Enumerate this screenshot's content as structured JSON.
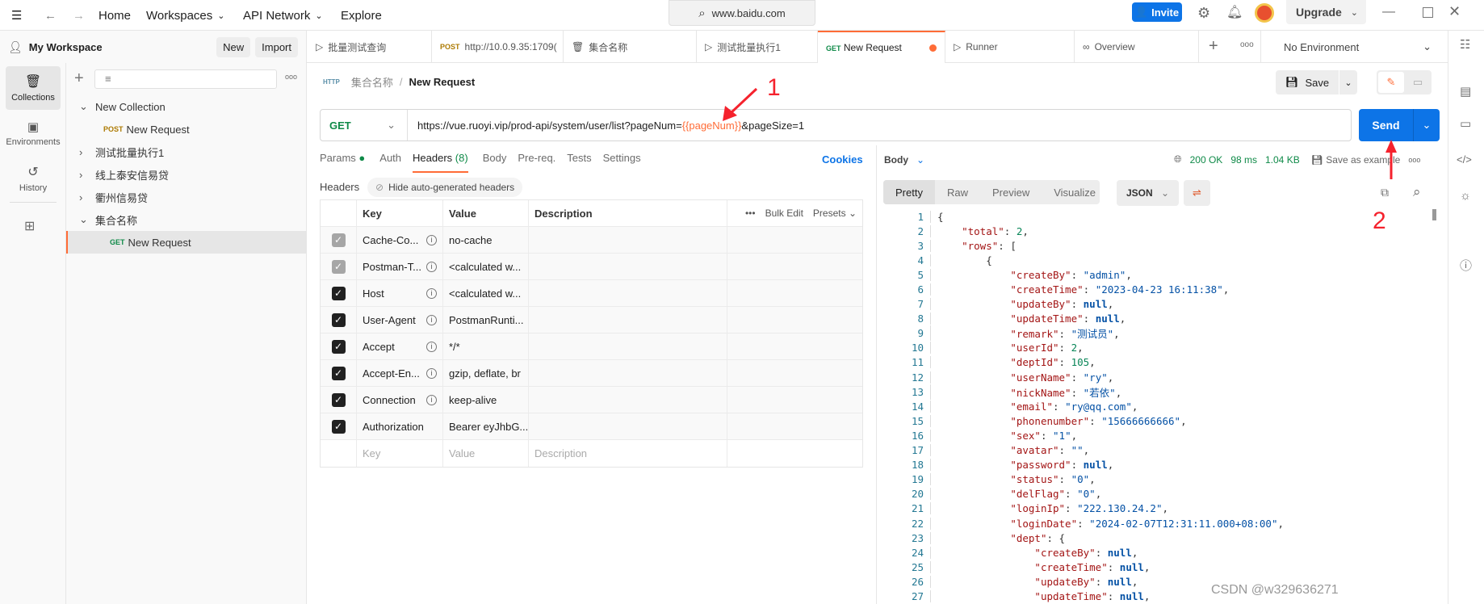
{
  "topbar": {
    "nav": [
      "Home",
      "Workspaces",
      "API Network",
      "Explore"
    ],
    "search": "www.baidu.com",
    "invite": "Invite",
    "upgrade": "Upgrade"
  },
  "workspace": {
    "name": "My Workspace",
    "new": "New",
    "import": "Import"
  },
  "tabs": [
    {
      "method": "",
      "label": "批量测试查询",
      "icon": "runner-icon"
    },
    {
      "method": "POST",
      "label": "http://10.0.9.35:1709("
    },
    {
      "method": "",
      "label": "集合名称",
      "icon": "collection-icon"
    },
    {
      "method": "",
      "label": "测试批量执行1",
      "icon": "runner-icon"
    },
    {
      "method": "GET",
      "label": "New Request",
      "active": true,
      "unsaved": true
    },
    {
      "method": "",
      "label": "Runner",
      "icon": "runner-icon"
    },
    {
      "method": "",
      "label": "Overview",
      "icon": "overview-icon"
    }
  ],
  "environment": "No Environment",
  "rail": [
    {
      "label": "Collections",
      "icon": "collections-icon",
      "selected": true
    },
    {
      "label": "Environments",
      "icon": "environments-icon"
    },
    {
      "label": "History",
      "icon": "history-icon"
    }
  ],
  "tree": [
    {
      "label": "New Collection",
      "expanded": true,
      "level": 0
    },
    {
      "label": "New Request",
      "method": "POST",
      "level": 1
    },
    {
      "label": "测试批量执行1",
      "expanded": false,
      "level": 0
    },
    {
      "label": "线上泰安信易贷",
      "expanded": false,
      "level": 0
    },
    {
      "label": "衢州信易贷",
      "expanded": false,
      "level": 0
    },
    {
      "label": "集合名称",
      "expanded": true,
      "level": 0
    },
    {
      "label": "New Request",
      "method": "GET",
      "level": 1,
      "selected": true
    }
  ],
  "breadcrumb": {
    "parent": "集合名称",
    "sep": "/",
    "current": "New Request"
  },
  "save": "Save",
  "request": {
    "method": "GET",
    "url_prefix": "https://vue.ruoyi.vip/prod-api/system/user/list?pageNum=",
    "url_var": "{{pageNum}}",
    "url_suffix": "&pageSize=1",
    "send": "Send"
  },
  "req_tabs": {
    "params": "Params",
    "auth": "Auth",
    "headers": "Headers",
    "headers_count": "(8)",
    "body": "Body",
    "prereq": "Pre-req.",
    "tests": "Tests",
    "settings": "Settings",
    "cookies": "Cookies"
  },
  "headers_section": {
    "title": "Headers",
    "hide": "Hide auto-generated headers"
  },
  "table": {
    "columns": [
      "Key",
      "Value",
      "Description"
    ],
    "bulk_edit": "Bulk Edit",
    "presets": "Presets",
    "rows": [
      {
        "key": "Cache-Co...",
        "value": "no-cache",
        "checked": true,
        "auto": true
      },
      {
        "key": "Postman-T...",
        "value": "<calculated w...",
        "checked": true,
        "auto": true
      },
      {
        "key": "Host",
        "value": "<calculated w...",
        "checked": true
      },
      {
        "key": "User-Agent",
        "value": "PostmanRunti...",
        "checked": true
      },
      {
        "key": "Accept",
        "value": "*/*",
        "checked": true
      },
      {
        "key": "Accept-En...",
        "value": "gzip, deflate, br",
        "checked": true
      },
      {
        "key": "Connection",
        "value": "keep-alive",
        "checked": true
      },
      {
        "key": "Authorization",
        "value": "Bearer eyJhbG...",
        "checked": true
      }
    ],
    "placeholders": {
      "key": "Key",
      "value": "Value",
      "description": "Description"
    }
  },
  "response": {
    "body_label": "Body",
    "status": "200 OK",
    "time": "98 ms",
    "size": "1.04 KB",
    "save_example": "Save as example",
    "views": [
      "Pretty",
      "Raw",
      "Preview",
      "Visualize"
    ],
    "format": "JSON",
    "lines": [
      [
        [
          "p",
          "{"
        ]
      ],
      [
        [
          "p",
          "    "
        ],
        [
          "k",
          "\"total\""
        ],
        [
          "p",
          ": "
        ],
        [
          "n",
          "2"
        ],
        [
          "p",
          ","
        ]
      ],
      [
        [
          "p",
          "    "
        ],
        [
          "k",
          "\"rows\""
        ],
        [
          "p",
          ": ["
        ]
      ],
      [
        [
          "p",
          "        {"
        ]
      ],
      [
        [
          "p",
          "            "
        ],
        [
          "k",
          "\"createBy\""
        ],
        [
          "p",
          ": "
        ],
        [
          "s",
          "\"admin\""
        ],
        [
          "p",
          ","
        ]
      ],
      [
        [
          "p",
          "            "
        ],
        [
          "k",
          "\"createTime\""
        ],
        [
          "p",
          ": "
        ],
        [
          "s",
          "\"2023-04-23 16:11:38\""
        ],
        [
          "p",
          ","
        ]
      ],
      [
        [
          "p",
          "            "
        ],
        [
          "k",
          "\"updateBy\""
        ],
        [
          "p",
          ": "
        ],
        [
          "nl",
          "null"
        ],
        [
          "p",
          ","
        ]
      ],
      [
        [
          "p",
          "            "
        ],
        [
          "k",
          "\"updateTime\""
        ],
        [
          "p",
          ": "
        ],
        [
          "nl",
          "null"
        ],
        [
          "p",
          ","
        ]
      ],
      [
        [
          "p",
          "            "
        ],
        [
          "k",
          "\"remark\""
        ],
        [
          "p",
          ": "
        ],
        [
          "s",
          "\"测试员\""
        ],
        [
          "p",
          ","
        ]
      ],
      [
        [
          "p",
          "            "
        ],
        [
          "k",
          "\"userId\""
        ],
        [
          "p",
          ": "
        ],
        [
          "n",
          "2"
        ],
        [
          "p",
          ","
        ]
      ],
      [
        [
          "p",
          "            "
        ],
        [
          "k",
          "\"deptId\""
        ],
        [
          "p",
          ": "
        ],
        [
          "n",
          "105"
        ],
        [
          "p",
          ","
        ]
      ],
      [
        [
          "p",
          "            "
        ],
        [
          "k",
          "\"userName\""
        ],
        [
          "p",
          ": "
        ],
        [
          "s",
          "\"ry\""
        ],
        [
          "p",
          ","
        ]
      ],
      [
        [
          "p",
          "            "
        ],
        [
          "k",
          "\"nickName\""
        ],
        [
          "p",
          ": "
        ],
        [
          "s",
          "\"若依\""
        ],
        [
          "p",
          ","
        ]
      ],
      [
        [
          "p",
          "            "
        ],
        [
          "k",
          "\"email\""
        ],
        [
          "p",
          ": "
        ],
        [
          "s",
          "\"ry@qq.com\""
        ],
        [
          "p",
          ","
        ]
      ],
      [
        [
          "p",
          "            "
        ],
        [
          "k",
          "\"phonenumber\""
        ],
        [
          "p",
          ": "
        ],
        [
          "s",
          "\"15666666666\""
        ],
        [
          "p",
          ","
        ]
      ],
      [
        [
          "p",
          "            "
        ],
        [
          "k",
          "\"sex\""
        ],
        [
          "p",
          ": "
        ],
        [
          "s",
          "\"1\""
        ],
        [
          "p",
          ","
        ]
      ],
      [
        [
          "p",
          "            "
        ],
        [
          "k",
          "\"avatar\""
        ],
        [
          "p",
          ": "
        ],
        [
          "s",
          "\"\""
        ],
        [
          "p",
          ","
        ]
      ],
      [
        [
          "p",
          "            "
        ],
        [
          "k",
          "\"password\""
        ],
        [
          "p",
          ": "
        ],
        [
          "nl",
          "null"
        ],
        [
          "p",
          ","
        ]
      ],
      [
        [
          "p",
          "            "
        ],
        [
          "k",
          "\"status\""
        ],
        [
          "p",
          ": "
        ],
        [
          "s",
          "\"0\""
        ],
        [
          "p",
          ","
        ]
      ],
      [
        [
          "p",
          "            "
        ],
        [
          "k",
          "\"delFlag\""
        ],
        [
          "p",
          ": "
        ],
        [
          "s",
          "\"0\""
        ],
        [
          "p",
          ","
        ]
      ],
      [
        [
          "p",
          "            "
        ],
        [
          "k",
          "\"loginIp\""
        ],
        [
          "p",
          ": "
        ],
        [
          "s",
          "\"222.130.24.2\""
        ],
        [
          "p",
          ","
        ]
      ],
      [
        [
          "p",
          "            "
        ],
        [
          "k",
          "\"loginDate\""
        ],
        [
          "p",
          ": "
        ],
        [
          "s",
          "\"2024-02-07T12:31:11.000+08:00\""
        ],
        [
          "p",
          ","
        ]
      ],
      [
        [
          "p",
          "            "
        ],
        [
          "k",
          "\"dept\""
        ],
        [
          "p",
          ": {"
        ]
      ],
      [
        [
          "p",
          "                "
        ],
        [
          "k",
          "\"createBy\""
        ],
        [
          "p",
          ": "
        ],
        [
          "nl",
          "null"
        ],
        [
          "p",
          ","
        ]
      ],
      [
        [
          "p",
          "                "
        ],
        [
          "k",
          "\"createTime\""
        ],
        [
          "p",
          ": "
        ],
        [
          "nl",
          "null"
        ],
        [
          "p",
          ","
        ]
      ],
      [
        [
          "p",
          "                "
        ],
        [
          "k",
          "\"updateBy\""
        ],
        [
          "p",
          ": "
        ],
        [
          "nl",
          "null"
        ],
        [
          "p",
          ","
        ]
      ],
      [
        [
          "p",
          "                "
        ],
        [
          "k",
          "\"updateTime\""
        ],
        [
          "p",
          ": "
        ],
        [
          "nl",
          "null"
        ],
        [
          "p",
          ","
        ]
      ]
    ]
  },
  "annotations": {
    "one": "1",
    "two": "2"
  },
  "watermark": "CSDN @w329636271",
  "colors": {
    "accent": "#ff6c37",
    "primary": "#0d74e7",
    "status_ok": "#0f8a48",
    "annotation": "#f5222d"
  }
}
